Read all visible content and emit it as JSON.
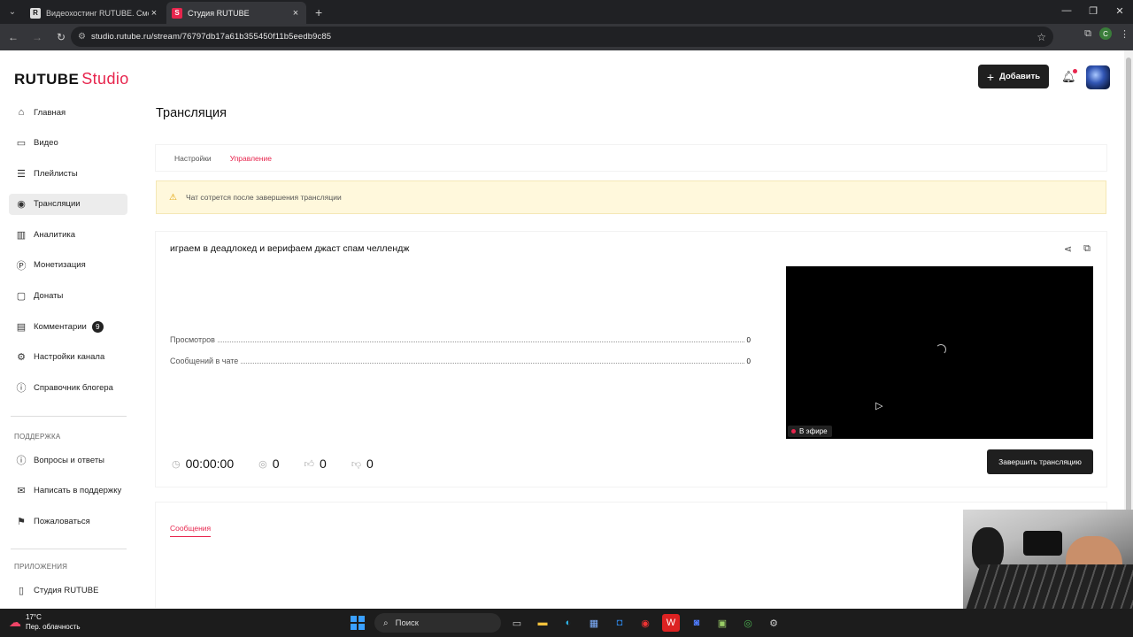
{
  "browser": {
    "tabs": [
      {
        "favicon": "R",
        "title": "Видеохостинг RUTUBE. Смотр",
        "active": false
      },
      {
        "favicon": "S",
        "title": "Студия RUTUBE",
        "active": true
      }
    ],
    "url": "studio.rutube.ru/stream/76797db17a61b355450f11b5eedb9c85",
    "profile_initial": "C"
  },
  "header": {
    "logo_main": "RUTUBE",
    "logo_sub": "Studio",
    "add_button": "Добавить"
  },
  "sidebar": {
    "items": [
      {
        "label": "Главная",
        "icon": "home-icon"
      },
      {
        "label": "Видео",
        "icon": "video-icon"
      },
      {
        "label": "Плейлисты",
        "icon": "playlist-icon"
      },
      {
        "label": "Трансляции",
        "icon": "broadcast-icon",
        "active": true
      },
      {
        "label": "Аналитика",
        "icon": "analytics-icon"
      },
      {
        "label": "Монетизация",
        "icon": "monetization-icon"
      },
      {
        "label": "Донаты",
        "icon": "donate-icon"
      },
      {
        "label": "Комментарии",
        "icon": "comment-icon",
        "badge": "9"
      },
      {
        "label": "Настройки канала",
        "icon": "gear-icon"
      },
      {
        "label": "Справочник блогера",
        "icon": "info-icon"
      }
    ],
    "support_heading": "ПОДДЕРЖКА",
    "support_items": [
      {
        "label": "Вопросы и ответы",
        "icon": "help-icon"
      },
      {
        "label": "Написать в поддержку",
        "icon": "mail-icon"
      },
      {
        "label": "Пожаловаться",
        "icon": "flag-icon"
      }
    ],
    "apps_heading": "ПРИЛОЖЕНИЯ",
    "apps_items": [
      {
        "label": "Студия RUTUBE",
        "icon": "app-icon"
      }
    ]
  },
  "main": {
    "title": "Трансляция",
    "tabs": [
      {
        "label": "Настройки",
        "active": false
      },
      {
        "label": "Управление",
        "active": true
      }
    ],
    "warning": "Чат сотрется после завершения трансляции",
    "stream": {
      "title": "играем в деадлокед и верифаем джаст спам челлендж",
      "stats": [
        {
          "label": "Просмотров",
          "value": "0"
        },
        {
          "label": "Сообщений в чате",
          "value": "0"
        }
      ],
      "live_label": "В эфире",
      "duration": "00:00:00",
      "viewers": "0",
      "likes": "0",
      "dislikes": "0",
      "end_button": "Завершить трансляцию"
    },
    "messages_tab": "Сообщения"
  },
  "taskbar": {
    "temperature": "17°C",
    "weather": "Пер. облачность",
    "search_label": "Поиск"
  },
  "colors": {
    "accent": "#e7254d",
    "dark_button": "#1f1f1f",
    "warning_bg": "#fff8dc"
  }
}
